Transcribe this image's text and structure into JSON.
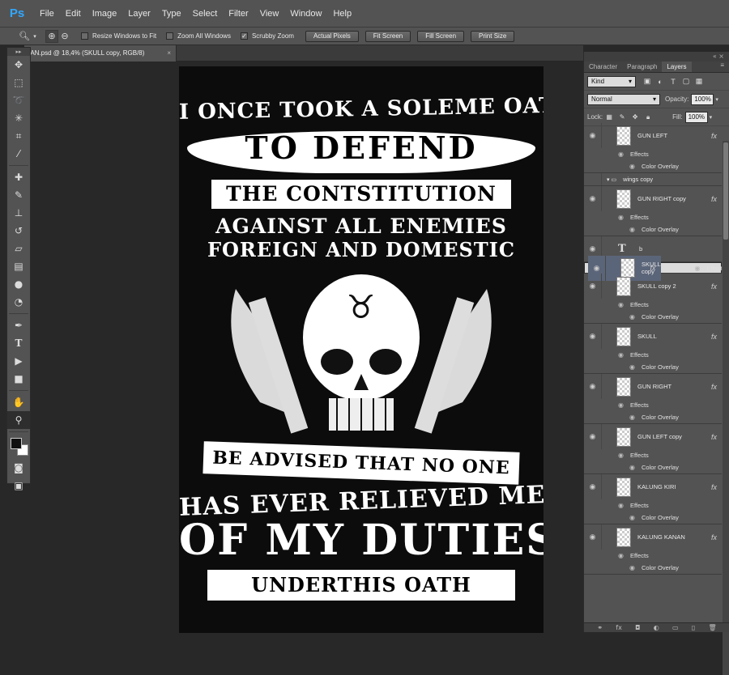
{
  "app": {
    "logo": "Ps"
  },
  "menu": [
    "File",
    "Edit",
    "Image",
    "Layer",
    "Type",
    "Select",
    "Filter",
    "View",
    "Window",
    "Help"
  ],
  "options": {
    "tool_icon": "zoom-icon",
    "resize_windows": "Resize Windows to Fit",
    "zoom_all": "Zoom All Windows",
    "scrubby": "Scrubby Zoom",
    "actual_pixels": "Actual Pixels",
    "fit_screen": "Fit Screen",
    "fill_screen": "Fill Screen",
    "print_size": "Print Size"
  },
  "document": {
    "tab_title": "KAN.psd @ 18,4% (SKULL copy, RGB/8)"
  },
  "artwork": {
    "line1": "I ONCE TOOK A SOLEME OATH",
    "line2": "TO DEFEND",
    "line3": "THE CONTSTITUTION",
    "line4": "AGAINST ALL ENEMIES",
    "line5": "FOREIGN AND DOMESTIC",
    "line6": "BE ADVISED THAT NO ONE",
    "line7": "HAS EVER RELIEVED ME",
    "line8": "OF MY DUTIES",
    "line9": "UNDERTHIS OATH",
    "skull_symbol": "♉"
  },
  "panel": {
    "tabs": [
      "Character",
      "Paragraph",
      "Layers"
    ],
    "kind": "Kind",
    "blend_mode": "Normal",
    "opacity_label": "Opacity:",
    "opacity": "100%",
    "lock_label": "Lock:",
    "fill_label": "Fill:",
    "fill": "100%",
    "effects_label": "Effects",
    "color_overlay": "Color Overlay"
  },
  "layers": [
    {
      "name": "GUN LEFT",
      "fx": true,
      "effects": true
    },
    {
      "name": "wings copy",
      "group": true
    },
    {
      "name": "GUN RIGHT copy",
      "fx": true,
      "effects": true
    },
    {
      "name": "b",
      "text": true
    },
    {
      "name": "SKULL copy",
      "fx": true,
      "effects": true,
      "selected": true
    },
    {
      "name": "SKULL copy 2",
      "fx": true,
      "effects": true
    },
    {
      "name": "SKULL",
      "fx": true,
      "effects": true
    },
    {
      "name": "GUN RIGHT",
      "fx": true,
      "effects": true
    },
    {
      "name": "GUN LEFT copy",
      "fx": true,
      "effects": true
    },
    {
      "name": "KALUNG KIRI",
      "fx": true,
      "effects": true
    },
    {
      "name": "KALUNG KANAN",
      "fx": true,
      "effects": true
    }
  ],
  "colors": {
    "accent": "#31a8ff",
    "selected_layer": "#5b6579"
  }
}
